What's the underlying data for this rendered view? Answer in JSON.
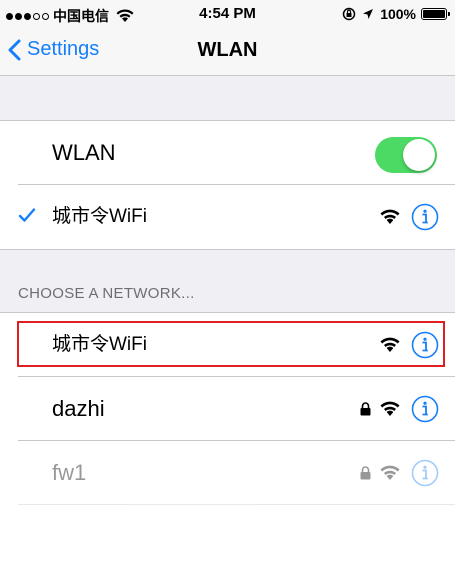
{
  "status_bar": {
    "carrier": "中国电信",
    "time": "4:54 PM",
    "battery": "100%",
    "signal_bars_filled": 3,
    "signal_bars_total": 5
  },
  "nav": {
    "back_label": "Settings",
    "title": "WLAN"
  },
  "wlan_toggle": {
    "label": "WLAN",
    "on": true
  },
  "connected_network": {
    "name": "城市令WiFi",
    "connected": true
  },
  "section_header": "CHOOSE A NETWORK...",
  "networks": [
    {
      "name": "城市令WiFi",
      "locked": false,
      "highlighted": true
    },
    {
      "name": "dazhi",
      "locked": true
    },
    {
      "name": "fw1",
      "locked": true,
      "faded": true
    }
  ],
  "colors": {
    "accent": "#157efb",
    "toggle_on": "#4cd964",
    "highlight": "#e02020",
    "background": "#efeff4"
  },
  "icons": [
    "chevron-left-icon",
    "wifi-icon",
    "lock-icon",
    "info-icon",
    "checkmark-icon",
    "location-icon",
    "orientation-lock-icon",
    "battery-icon"
  ]
}
